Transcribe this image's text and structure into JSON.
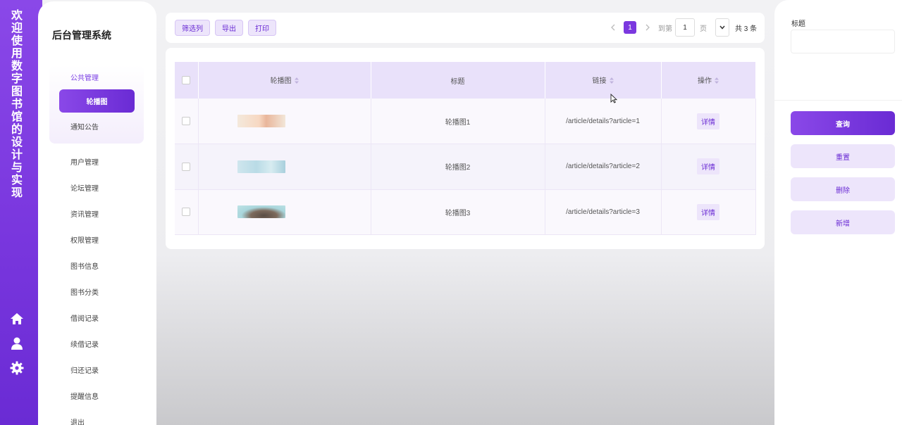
{
  "app": {
    "vertical_title": "欢迎使用数字图书馆的设计与实现",
    "system_title": "后台管理系统"
  },
  "sidebar": {
    "group_label": "公共管理",
    "active_item": "轮播图",
    "sub_item": "通知公告",
    "items": [
      {
        "label": "用户管理"
      },
      {
        "label": "论坛管理"
      },
      {
        "label": "资讯管理"
      },
      {
        "label": "权限管理"
      },
      {
        "label": "图书信息"
      },
      {
        "label": "图书分类"
      },
      {
        "label": "借阅记录"
      },
      {
        "label": "续借记录"
      },
      {
        "label": "归还记录"
      },
      {
        "label": "提醒信息"
      },
      {
        "label": "退出"
      }
    ],
    "bottom_icons": [
      "home-icon",
      "user-icon",
      "gear-icon"
    ]
  },
  "toolbar": {
    "filter_label": "筛选列",
    "export_label": "导出",
    "print_label": "打印",
    "pager": {
      "current_page": "1",
      "goto_label": "到第",
      "goto_value": "1",
      "page_unit": "页",
      "total_text": "共 3 条"
    }
  },
  "table": {
    "headers": {
      "image": "轮播图",
      "title": "标题",
      "link": "链接",
      "action": "操作"
    },
    "rows": [
      {
        "title": "轮播图1",
        "link": "/article/details?article=1",
        "action": "详情"
      },
      {
        "title": "轮播图2",
        "link": "/article/details?article=2",
        "action": "详情"
      },
      {
        "title": "轮播图3",
        "link": "/article/details?article=3",
        "action": "详情"
      }
    ]
  },
  "search_panel": {
    "field_label": "标题",
    "field_value": "",
    "query_label": "查询",
    "reset_label": "重置",
    "delete_label": "删除",
    "add_label": "新增"
  },
  "colors": {
    "accent": "#7b38df",
    "accent_light": "#ede5fb",
    "header_bg": "#e9e1fa"
  }
}
